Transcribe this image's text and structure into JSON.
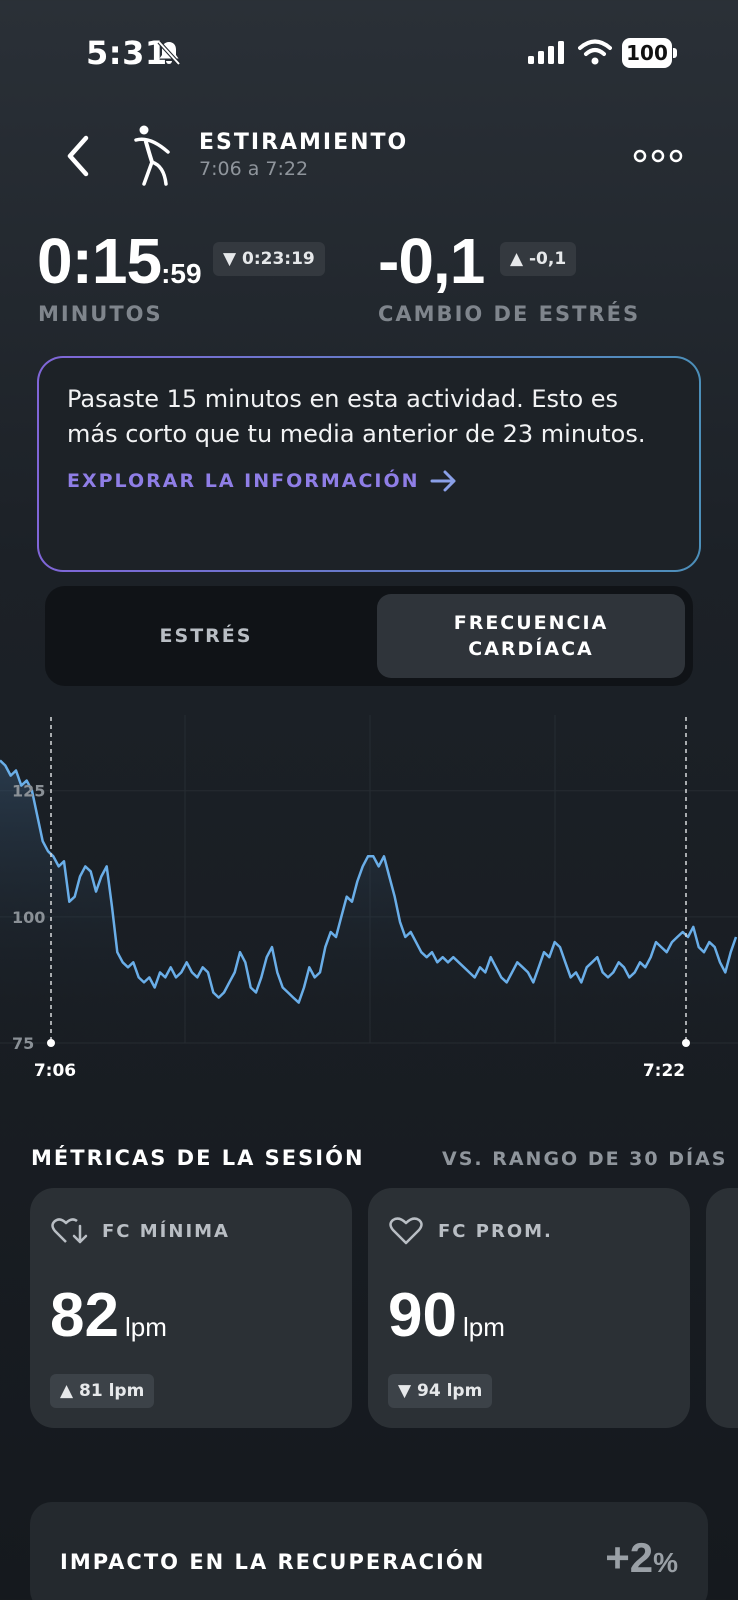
{
  "status_bar": {
    "time": "5:31",
    "battery": "100"
  },
  "header": {
    "title": "ESTIRAMIENTO",
    "subtitle": "7:06 a 7:22"
  },
  "stats": {
    "duration_main": "0:15",
    "duration_seconds": ":59",
    "duration_compare": "0:23:19",
    "duration_label": "MINUTOS",
    "stress_value": "-0,1",
    "stress_compare": "-0,1",
    "stress_label": "CAMBIO DE ESTRÉS"
  },
  "insight": {
    "text": "Pasaste 15 minutos en esta actividad. Esto es más corto que tu media anterior de 23 minutos.",
    "link": "EXPLORAR LA INFORMACIÓN"
  },
  "toggle": {
    "stress": "ESTRÉS",
    "heart_rate_line1": "FRECUENCIA",
    "heart_rate_line2": "CARDÍACA",
    "selected": "heart_rate"
  },
  "chart_data": {
    "type": "line",
    "y_ticks": [
      "125",
      "100",
      "75"
    ],
    "ylim": [
      75,
      140
    ],
    "start_label": "7:06",
    "end_label": "7:22",
    "line_color": "#6aaee8",
    "series": [
      {
        "values": [
          131,
          130,
          128,
          129,
          126,
          127,
          125,
          120,
          115,
          113,
          112,
          110,
          111,
          103,
          104,
          108,
          110,
          109,
          105,
          108,
          110,
          102,
          93,
          91,
          90,
          91,
          88,
          87,
          88,
          86,
          89,
          88,
          90,
          88,
          89,
          91,
          89,
          88,
          90,
          89,
          85,
          84,
          85,
          87,
          89,
          93,
          91,
          86,
          85,
          88,
          92,
          94,
          89,
          86,
          85,
          84,
          83,
          86,
          90,
          88,
          89,
          94,
          97,
          96,
          100,
          104,
          103,
          107,
          110,
          112,
          112,
          110,
          112,
          108,
          104,
          99,
          96,
          97,
          95,
          93,
          92,
          93,
          91,
          92,
          91,
          92,
          91,
          90,
          89,
          88,
          90,
          89,
          92,
          90,
          88,
          87,
          89,
          91,
          90,
          89,
          87,
          90,
          93,
          92,
          95,
          94,
          91,
          88,
          89,
          87,
          90,
          91,
          92,
          89,
          88,
          89,
          91,
          90,
          88,
          89,
          91,
          90,
          92,
          95,
          94,
          93,
          95,
          96,
          97,
          96,
          98,
          94,
          93,
          95,
          94,
          91,
          89,
          93,
          96
        ]
      }
    ]
  },
  "metrics": {
    "title": "MÉTRICAS DE LA SESIÓN",
    "comparison": "VS. RANGO DE 30 DÍAS",
    "cards": [
      {
        "label": "FC MÍNIMA",
        "value": "82",
        "unit": "lpm",
        "compare": "81 lpm",
        "direction": "up"
      },
      {
        "label": "FC PROM.",
        "value": "90",
        "unit": "lpm",
        "compare": "94 lpm",
        "direction": "down"
      }
    ]
  },
  "recovery": {
    "title": "IMPACTO EN LA RECUPERACIÓN",
    "value": "+2",
    "unit": "%"
  }
}
